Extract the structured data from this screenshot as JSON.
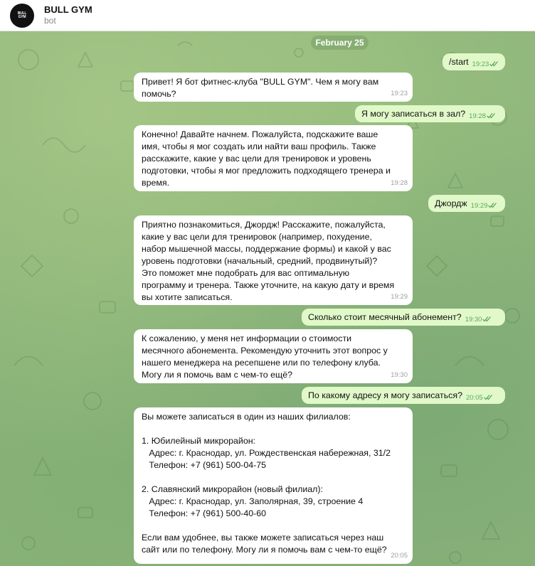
{
  "header": {
    "avatar_text": "BULL GYM",
    "title": "BULL GYM",
    "subtitle": "bot"
  },
  "chat": {
    "date_label": "February 25",
    "messages": [
      {
        "direction": "out",
        "text": "/start",
        "time": "19:23"
      },
      {
        "direction": "in",
        "text": "Привет! Я бот фитнес-клуба \"BULL GYM\". Чем я могу вам\nпомочь?",
        "time": "19:23"
      },
      {
        "direction": "out",
        "text": "Я могу записаться в зал?",
        "time": "19:28"
      },
      {
        "direction": "in",
        "text": "Конечно! Давайте начнем. Пожалуйста, подскажите ваше\nимя, чтобы я мог создать или найти ваш профиль. Также\nрасскажите, какие у вас цели для тренировок и уровень\nподготовки, чтобы я мог предложить подходящего тренера и\nвремя.",
        "time": "19:28"
      },
      {
        "direction": "out",
        "text": "Джордж",
        "time": "19:29"
      },
      {
        "direction": "in",
        "text": "Приятно познакомиться, Джордж! Расскажите, пожалуйста,\nкакие у вас цели для тренировок (например, похудение,\nнабор мышечной массы, поддержание формы) и какой у вас\nуровень подготовки (начальный, средний, продвинутый)?\nЭто поможет мне подобрать для вас оптимальную\nпрограмму и тренера. Также уточните, на какую дату и время\nвы хотите записаться.",
        "time": "19:29"
      },
      {
        "direction": "out",
        "text": "Сколько стоит месячный абонемент?",
        "time": "19:30"
      },
      {
        "direction": "in",
        "text": "К сожалению, у меня нет информации о стоимости\nмесячного абонемента. Рекомендую уточнить этот вопрос у\nнашего менеджера на ресепшене или по телефону клуба.\nМогу ли я помочь вам с чем-то ещё?",
        "time": "19:30"
      },
      {
        "direction": "out",
        "text": "По какому адресу я могу записаться?",
        "time": "20:05"
      },
      {
        "direction": "in",
        "text": "Вы можете записаться в один из наших филиалов:\n\n1. Юбилейный микрорайон:\n   Адрес: г. Краснодар, ул. Рождественская набережная, 31/2\n   Телефон: +7 (961) 500-04-75\n\n2. Славянский микрорайон (новый филиал):\n   Адрес: г. Краснодар, ул. Заполярная, 39, строение 4\n   Телефон: +7 (961) 500-40-60\n\nЕсли вам удобнее, вы также можете записаться через наш\nсайт или по телефону. Могу ли я помочь вам с чем-то ещё?",
        "time": "20:05"
      }
    ]
  },
  "icons": {
    "read_receipt": "double-check-icon",
    "avatar": "bull-logo-icon"
  },
  "colors": {
    "chat_background": "#8fb57c",
    "incoming_bubble": "#ffffff",
    "outgoing_bubble": "#e1f9c9",
    "check_color": "#5fa75f"
  }
}
